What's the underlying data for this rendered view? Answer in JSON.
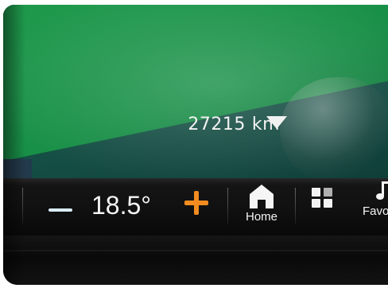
{
  "map": {
    "distance_value": "27215",
    "distance_unit": "km"
  },
  "bottom_bar": {
    "temperature": "18.5°",
    "home_label": "Home",
    "favorites_label": "Favori"
  },
  "colors": {
    "map_green": "#1a8f47",
    "map_dark": "#134d43",
    "accent_orange": "#f28c21",
    "minus_blue": "#d9edf6",
    "bar_background": "#111111"
  },
  "icons": {
    "minus": "minus-icon",
    "plus": "plus-icon",
    "home": "home-icon",
    "apps": "apps-icon",
    "favorites": "music-note-icon",
    "dropdown": "dropdown-arrow-icon"
  }
}
